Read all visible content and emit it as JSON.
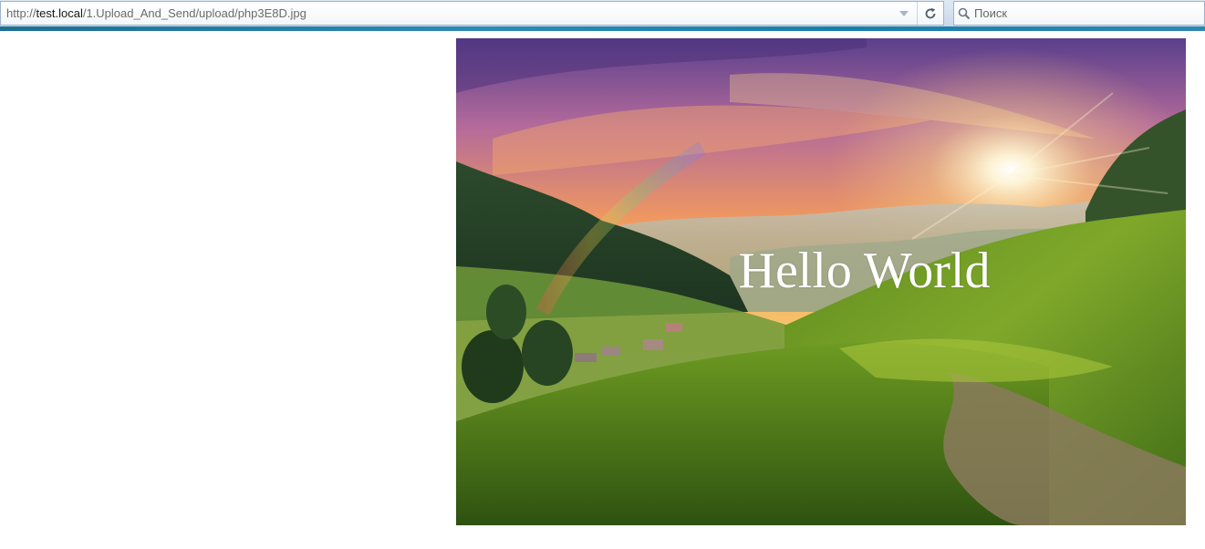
{
  "browser": {
    "url_scheme": "http://",
    "url_host": "test.local",
    "url_path": "/1.Upload_And_Send/upload/php3E8D.jpg",
    "search_placeholder": "Поиск",
    "icons": {
      "dropdown": "chevron-down-icon",
      "reload": "reload-icon",
      "search": "search-icon"
    }
  },
  "image": {
    "caption": "Hello World",
    "scene": "sunset-mountain-valley"
  },
  "colors": {
    "accent": "#2c8ab3",
    "caption": "#ffffff"
  }
}
